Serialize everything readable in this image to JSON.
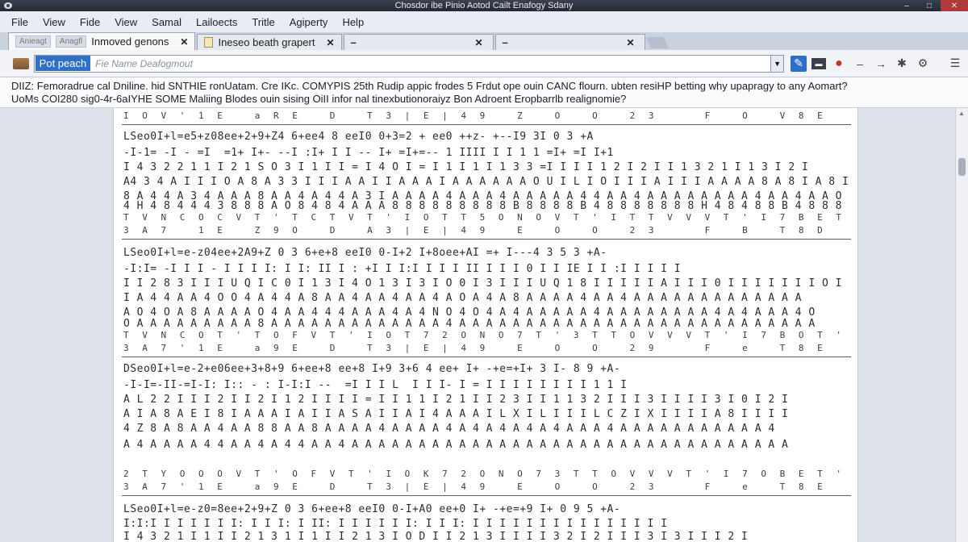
{
  "window": {
    "title": "Chosdor ibe Pinio Aotod Cailt Enafogy Sdany",
    "buttons": [
      "min",
      "restore",
      "close"
    ]
  },
  "menu": [
    "File",
    "View",
    "Fide",
    "View",
    "Samal",
    "Lailoects",
    "Tritle",
    "Agiperty",
    "Help"
  ],
  "tabs": [
    {
      "label": "Inmoved genons",
      "prefix_a": "Anieagt",
      "prefix_b": "Anagfl",
      "active": true
    },
    {
      "label": "Ineseo beath grapert",
      "active": false
    },
    {
      "label": "–",
      "active": false
    },
    {
      "label": "–",
      "active": false
    }
  ],
  "toolbar": {
    "address_selected": "Pot peach",
    "address_placeholder": "Fie Name Deafogmout"
  },
  "infobar": {
    "line1": "DIIZ: Femoradrue cal Dniline. hid SNTHIE ronUatam. Cre IKc. COMYPIS 25th Rudip appic frodes 5 Frdut ope ouin CANC flourn. ubten resiHP betting why upapragy to any Aomart?",
    "line2": "UoMs COI280 sig0-4r-6aIYHE SOME Maliing Blodes ouin sising OiII infor nal tinexbutionoraiyz Bon Adroent Eropbarrlb realignomie?"
  },
  "document": {
    "blocks": [
      {
        "header": "I O V ' 1 E   a R E   D   T 3 | E | 4 9   Z   O   O   2 3     F   O   V 8 E",
        "rows": [
          "LSeo0I+l=e5+z08ee+2+9+Z4 6+ee4 8 eeI0 0+3=2 + ee0 ++z- +--I9 3I 0 3 +A",
          "-I-1= -I - =I  =1+ I+- --I :I+ I I -- I+ =I+=-- 1 IIII I I 1 1 =I+ =I I+1",
          "I 4 3 2 2 1 1 I 2 1 S O 3 I 1 I I = I 4 O I = I 1 I 1 I 1 3 3 =I I I I 1 2 I 2 I I 1 3 2 1 I 1 3 I 2 I",
          "A4 3 4 A I I I O A 8 A 3 3 I I I A A I I A A A I A A A A A A O U I L I O I I I A I I I A A A A 8 A 8 I A 8 I I A",
          "8 A 4 4 A 3 4 A A A 8 A A 4 A 4 4 A 3 I A A A A 4 A A A 4 A A A A A 4 4 A A 4 A A A A A A A A 4 A A 4 A A O 4",
          "4 H 4 8 4 4 4 3 8 8 8 A O 8 4 8 4 A A A 8 8 8 8 8 8 8 8 8 B 8 8 8 8 B 4 8 8 8 8 8 8 8 H 4 8 4 8 8 B 4 8 8 8 8"
        ],
        "footer": "T V N C O C V T ' T C T V T ' I O T T 5 O N O V T ' I T T V V V T ' I 7 B E T ' D B   D V T A D O -"
      },
      {
        "header": "3 A 7   1 E   Z 9 O   D   A 3 | E | 4 9   E   O   O   2 3     F   B   T 8 D",
        "rows": [
          "LSeo0I+l=e-z04ee+2A9+Z 0 3 6+e+8 eeI0 0-I+2 I+8oee+AI =+ I---4 3 5 3 +A-",
          "-I:I= -I I I - I I I I: I I: II I : +I I I:I I I I II I I I 0 I I IE I I :I I I I I",
          "I I 2 8 3 I I I U Q I C 0 I 1 3 I 4 O 1 3 I 3 I O 0 I 3 I I I U Q 1 8 I I I I I A I I I 0 I I I I I I I O I I I I",
          "I A 4 4 A A 4 O O 4 A 4 4 A 8 A A 4 A A 4 A A 4 A O A 4 A 8 A A A A 4 A A 4 A A A A A A A A A A A A A",
          "A O 4 O A 8 A A A A O 4 A A 4 4 4 A A A 4 A 4 N O 4 O 4 A 4 A A A A A 4 A A A A A A A A 4 A 4 A A A 4 O",
          "O A A A A A A A A A 8 A A A A A A A A A A A A A 4 A A A A A A A A A A A A A A A A A A A A A A A A A A A"
        ],
        "footer": "T V N C O T ' T O F V T ' I O T 7 2 O N O 7 T ' 3 T T O V V V T ' I 7 B O T ' D B ' D V T A D B ?"
      },
      {
        "header": "3 A 7 ' 1 E   a 9 E   D   T 3 | E | 4 9   E   O   O   2 9     F   e   T 8 E",
        "rows": [
          "DSeo0I+l=e-2+e06ee+3+8+9 6+ee+8 ee+8 I+9 3+6 4 ee+ I+ -+e=+I+ 3 I- 8 9 +A-",
          "-I-I=-II-=I-I: I:: - : I-I:I --  =I I I L  I I I- I = I I I I I I I I 1 1 I",
          "A L 2 2 I I I 2 I I 2 I 1 2 I I I I = I I 1 1 I 2 1 I I 2 3 I I 1 1 3 2 I I I 3 I I I I 3 I 0 I 2 I",
          "A I A 8 A E I 8 I A A A I A I I A S A I I A I 4 A A A I L X I L I I I L C Z I X I I I I A 8 I I I I",
          "4 Z 8 A 8 A A 4 A A 8 8 A A 8 A A A A 4 A A A A 4 A 4 A 4 A 4 A 4 A A A 4 A A A A A A A A A A A 4",
          "A 4 A A A A 4 4 A A 4 A 4 4 A A 4 A A A A A A A A A A A A A A A A A A A A A A A A A A A A A A A A A"
        ],
        "footer": "2 T Y O O O V T ' O F V T ' I O K 7 2 O N O 7 3 T T O V V V T ' I 7 O B E T ' D B C ' D V T A D O ."
      },
      {
        "header": "3 A 7 ' 1 E   a 9 E   D   T 3 | E | 4 9   E   O   O   2 3     F   e   T 8 E",
        "rows": [
          "LSeo0I+l=e-z0=8ee+2+9+Z 0 3 6+ee+8 eeI0 0-I+A0 ee+0 I+ -+e=+9 I+ 0 9 5 +A-",
          "I:I:I I I I I I I: I I I: I II: I I I I I I: I I I: I I I I I I I I I I I I I I I",
          "I 4 3 2 1 I 1 I I 2 1 3 1 I 1 I I 2 1 3 I O D I I 2 1 3 I I I I 3 2 I 2 I I I 3 I 3 I I I 2 I"
        ],
        "footer": ""
      }
    ]
  }
}
